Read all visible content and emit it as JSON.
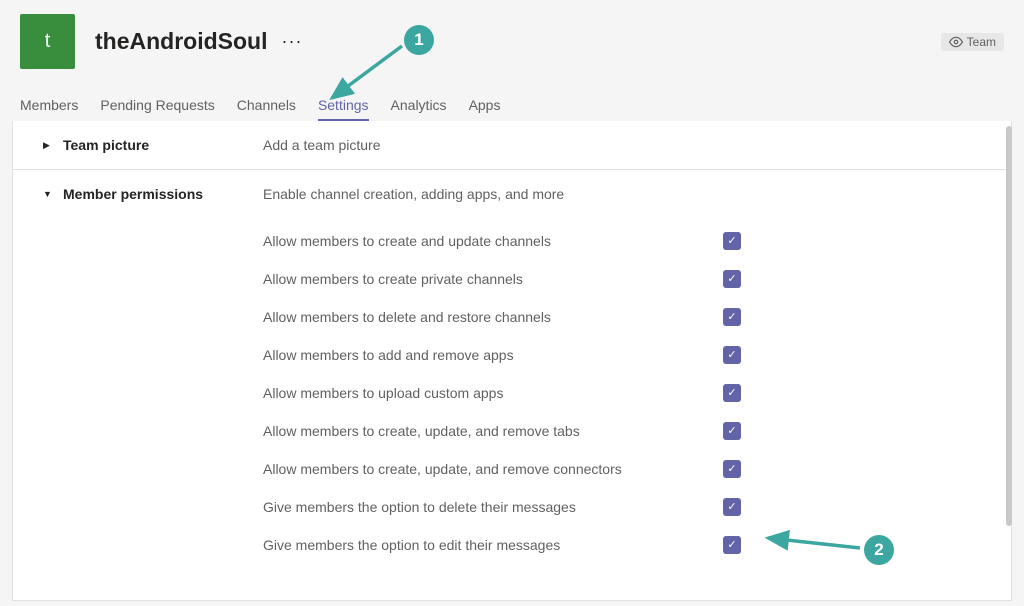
{
  "team": {
    "avatar_letter": "t",
    "name": "theAndroidSoul",
    "badge": "Team"
  },
  "tabs": [
    {
      "label": "Members",
      "active": false
    },
    {
      "label": "Pending Requests",
      "active": false
    },
    {
      "label": "Channels",
      "active": false
    },
    {
      "label": "Settings",
      "active": true
    },
    {
      "label": "Analytics",
      "active": false
    },
    {
      "label": "Apps",
      "active": false
    }
  ],
  "sections": {
    "team_picture": {
      "title": "Team picture",
      "desc": "Add a team picture",
      "expanded": false
    },
    "member_permissions": {
      "title": "Member permissions",
      "desc": "Enable channel creation, adding apps, and more",
      "expanded": true,
      "items": [
        {
          "label": "Allow members to create and update channels",
          "checked": true
        },
        {
          "label": "Allow members to create private channels",
          "checked": true
        },
        {
          "label": "Allow members to delete and restore channels",
          "checked": true
        },
        {
          "label": "Allow members to add and remove apps",
          "checked": true
        },
        {
          "label": "Allow members to upload custom apps",
          "checked": true
        },
        {
          "label": "Allow members to create, update, and remove tabs",
          "checked": true
        },
        {
          "label": "Allow members to create, update, and remove connectors",
          "checked": true
        },
        {
          "label": "Give members the option to delete their messages",
          "checked": true
        },
        {
          "label": "Give members the option to edit their messages",
          "checked": true
        }
      ]
    }
  },
  "callouts": {
    "one": "1",
    "two": "2"
  }
}
